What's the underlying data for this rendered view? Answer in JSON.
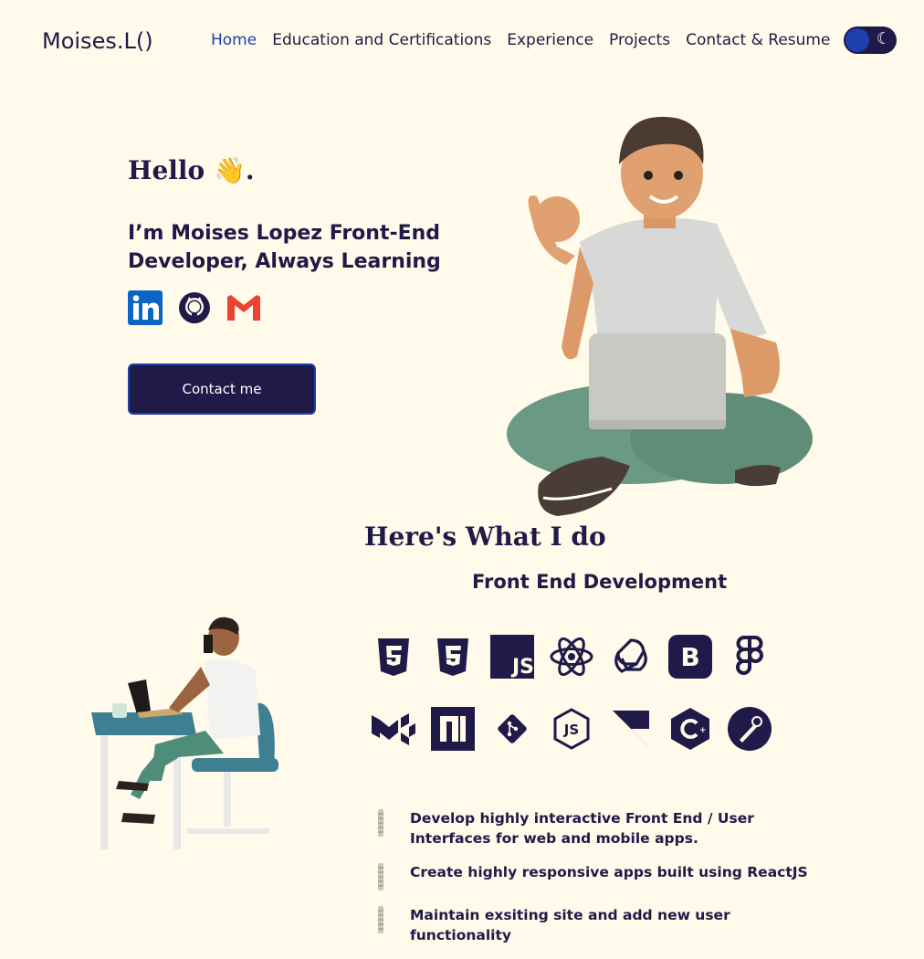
{
  "nav": {
    "logo": "Moises.L()",
    "items": [
      {
        "label": "Home"
      },
      {
        "label": "Education and Certifications"
      },
      {
        "label": "Experience"
      },
      {
        "label": "Projects"
      },
      {
        "label": "Contact & Resume"
      }
    ],
    "active_index": 0,
    "theme_icon": "moon-icon"
  },
  "hero": {
    "greeting": "Hello 👋.",
    "intro": "I’m Moises Lopez Front-End Developer, Always Learning",
    "socials": [
      {
        "icon": "linkedin-icon"
      },
      {
        "icon": "github-icon"
      },
      {
        "icon": "gmail-icon"
      }
    ],
    "contact_label": "Contact me"
  },
  "skills": {
    "title": "Here's What I do",
    "subtitle": "Front End Development",
    "icons_row1": [
      "html5-icon",
      "css3-icon",
      "javascript-icon",
      "react-icon",
      "openai-icon",
      "bootstrap-icon",
      "figma-icon"
    ],
    "icons_row2": [
      "material-ui-icon",
      "nextjs-icon",
      "git-icon",
      "nodejs-icon",
      "framer-icon",
      "csharp-icon",
      "postman-icon"
    ],
    "bullets": [
      {
        "text": "Develop highly interactive Front End / User Interfaces for web and mobile apps."
      },
      {
        "text": "Create highly responsive apps built using ReactJS"
      },
      {
        "text": "Maintain exsiting site and add new user functionality"
      }
    ]
  },
  "colors": {
    "background": "#fffae9",
    "primary": "#1f1a48",
    "accent": "#1e40af",
    "gmail": "#ea4335",
    "linkedin": "#0a66c2"
  }
}
